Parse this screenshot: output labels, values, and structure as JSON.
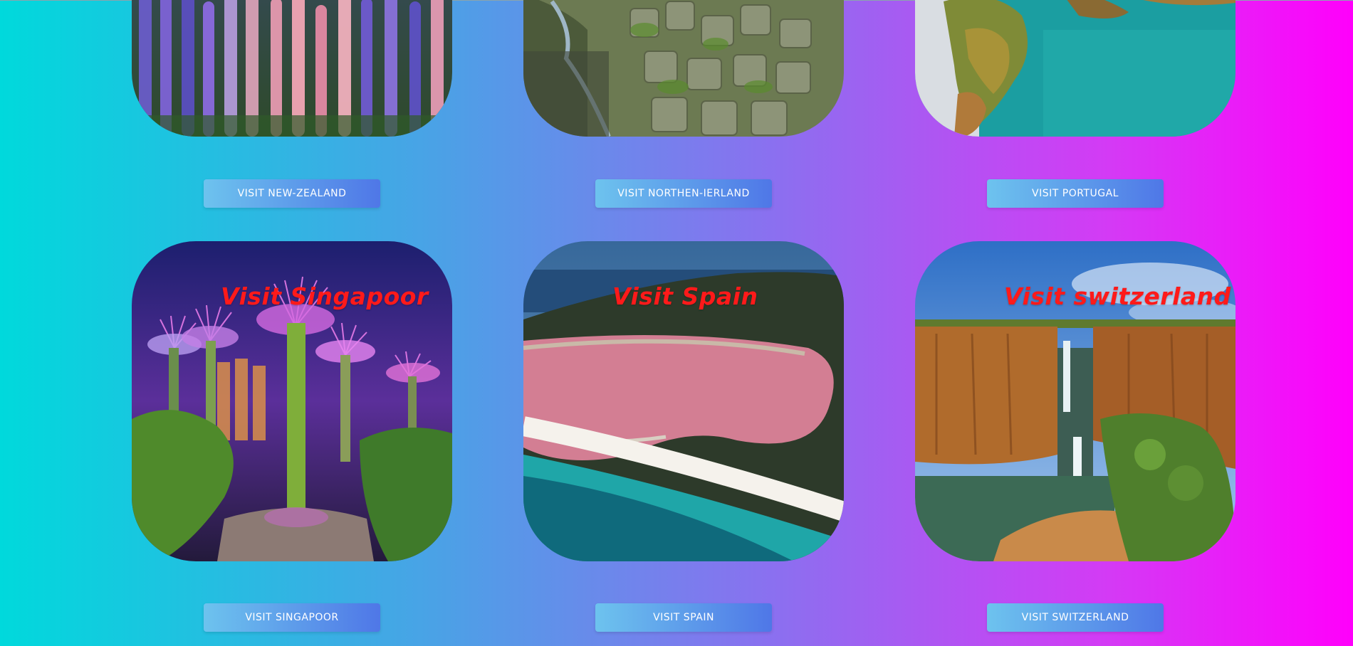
{
  "destinations": [
    {
      "country": "New Zealand",
      "title": "",
      "button_label": "VISIT NEW-ZEALAND",
      "image": "lupin-flower-field"
    },
    {
      "country": "Northern Ireland",
      "title": "",
      "button_label": "VISIT NORTHEN-IERLAND",
      "image": "basalt-column-coast"
    },
    {
      "country": "Portugal",
      "title": "",
      "button_label": "VISIT PORTUGAL",
      "image": "rocky-coast-turquoise-sea"
    },
    {
      "country": "Singapore",
      "title": "Visit Singapoor",
      "button_label": "VISIT SINGAPOOR",
      "image": "supertree-grove-night"
    },
    {
      "country": "Spain",
      "title": "Visit Spain",
      "button_label": "VISIT SPAIN",
      "image": "pink-lake-aerial"
    },
    {
      "country": "Switzerland",
      "title": "Visit switzerland",
      "button_label": "VISIT SWITZERLAND",
      "image": "canyon-waterfall"
    }
  ],
  "colors": {
    "background_gradient": [
      "#00d9dc",
      "#4aa2e6",
      "#8d6ef0",
      "#d43af5",
      "#ff00fb"
    ],
    "button_gradient": [
      "#6dc3ee",
      "#4f77e7"
    ],
    "button_text": "#ffffff",
    "card_title": "#ff1a1a"
  }
}
